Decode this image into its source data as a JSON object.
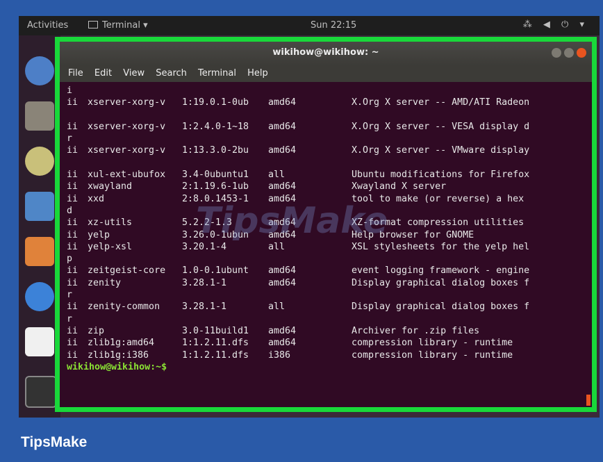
{
  "desktop": {
    "activities": "Activities",
    "app_menu": "Terminal ▾",
    "clock": "Sun 22:15",
    "tray": "⁂ ◀ ⏻ ▾"
  },
  "window": {
    "title": "wikihow@wikihow: ~",
    "menu": [
      "File",
      "Edit",
      "View",
      "Search",
      "Terminal",
      "Help"
    ]
  },
  "terminal": {
    "rows": [
      {
        "t": "i"
      },
      {
        "c": [
          "ii",
          "xserver-xorg-v",
          "1:19.0.1-0ub",
          "amd64",
          "X.Org X server -- AMD/ATI Radeon"
        ]
      },
      {
        "t": ""
      },
      {
        "c": [
          "ii",
          "xserver-xorg-v",
          "1:2.4.0-1~18",
          "amd64",
          "X.Org X server -- VESA display d"
        ]
      },
      {
        "t": "r"
      },
      {
        "c": [
          "ii",
          "xserver-xorg-v",
          "1:13.3.0-2bu",
          "amd64",
          "X.Org X server -- VMware display"
        ]
      },
      {
        "t": ""
      },
      {
        "c": [
          "ii",
          "xul-ext-ubufox",
          "3.4-0ubuntu1",
          "all",
          "Ubuntu modifications for Firefox"
        ]
      },
      {
        "c": [
          "ii",
          "xwayland",
          "2:1.19.6-1ub",
          "amd64",
          "Xwayland X server"
        ]
      },
      {
        "c": [
          "ii",
          "xxd",
          "2:8.0.1453-1",
          "amd64",
          "tool to make (or reverse) a hex"
        ]
      },
      {
        "t": "d"
      },
      {
        "c": [
          "ii",
          "xz-utils",
          "5.2.2-1.3",
          "amd64",
          "XZ-format compression utilities"
        ]
      },
      {
        "c": [
          "ii",
          "yelp",
          "3.26.0-1ubun",
          "amd64",
          "Help browser for GNOME"
        ]
      },
      {
        "c": [
          "ii",
          "yelp-xsl",
          "3.20.1-4",
          "all",
          "XSL stylesheets for the yelp hel"
        ]
      },
      {
        "t": "p"
      },
      {
        "c": [
          "ii",
          "zeitgeist-core",
          "1.0-0.1ubunt",
          "amd64",
          "event logging framework - engine"
        ]
      },
      {
        "c": [
          "ii",
          "zenity",
          "3.28.1-1",
          "amd64",
          "Display graphical dialog boxes f"
        ]
      },
      {
        "t": "r"
      },
      {
        "c": [
          "ii",
          "zenity-common",
          "3.28.1-1",
          "all",
          "Display graphical dialog boxes f"
        ]
      },
      {
        "t": "r"
      },
      {
        "c": [
          "ii",
          "zip",
          "3.0-11build1",
          "amd64",
          "Archiver for .zip files"
        ]
      },
      {
        "c": [
          "ii",
          "zlib1g:amd64",
          "1:1.2.11.dfs",
          "amd64",
          "compression library - runtime"
        ]
      },
      {
        "c": [
          "ii",
          "zlib1g:i386",
          "1:1.2.11.dfs",
          "i386",
          "compression library - runtime"
        ]
      }
    ],
    "prompt": "wikihow@wikihow:~$"
  },
  "watermark": "TipsMake",
  "brand": "TipsMake",
  "colors": {
    "page_bg": "#2a5aa8",
    "highlight": "#19d83a",
    "terminal_bg": "#300a24",
    "prompt": "#8ae234",
    "close_button": "#e9541f"
  }
}
